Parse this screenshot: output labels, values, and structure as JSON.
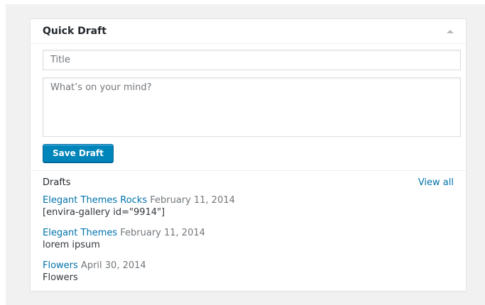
{
  "widget": {
    "title": "Quick Draft",
    "toggle_icon": "arrow-up-icon"
  },
  "form": {
    "title_placeholder": "Title",
    "title_value": "",
    "content_placeholder": "What’s on your mind?",
    "content_value": "",
    "save_label": "Save Draft"
  },
  "drafts": {
    "heading": "Drafts",
    "view_all_label": "View all",
    "items": [
      {
        "title": "Elegant Themes Rocks",
        "date": "February 11, 2014",
        "excerpt": "[envira-gallery id=\"9914\"]"
      },
      {
        "title": "Elegant Themes",
        "date": "February 11, 2014",
        "excerpt": "lorem ipsum"
      },
      {
        "title": "Flowers",
        "date": "April 30, 2014",
        "excerpt": "Flowers"
      }
    ]
  },
  "colors": {
    "background": "#f1f1f1",
    "panel": "#ffffff",
    "border": "#e5e5e5",
    "primary_button": "#0085ba",
    "link": "#0073aa",
    "muted_text": "#72777c",
    "text": "#32373c"
  }
}
